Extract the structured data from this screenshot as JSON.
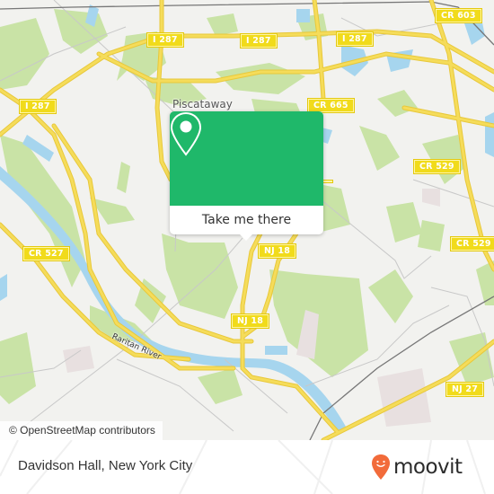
{
  "map": {
    "colors": {
      "background": "#f2f2ef",
      "park": "#c9e3a6",
      "water": "#a6d5ee",
      "road": "#f5dc5a",
      "road_casing": "#e8c83a",
      "rail": "#777777",
      "minor_road": "#c8c8c8",
      "industrial": "#e8e0e0"
    },
    "road_shields": [
      {
        "label": "I 287",
        "id": "i287-west"
      },
      {
        "label": "I 287",
        "id": "i287-north-1"
      },
      {
        "label": "I 287",
        "id": "i287-north-2"
      },
      {
        "label": "I 287",
        "id": "i287-north-3"
      },
      {
        "label": "CR 603",
        "id": "cr603"
      },
      {
        "label": "CR 665",
        "id": "cr665"
      },
      {
        "label": "CR 529",
        "id": "cr529-1"
      },
      {
        "label": "CR 529",
        "id": "cr529-2"
      },
      {
        "label": "CR 527",
        "id": "cr527"
      },
      {
        "label": "NJ 18",
        "id": "nj18-1"
      },
      {
        "label": "NJ 18",
        "id": "nj18-2"
      },
      {
        "label": "NJ 27",
        "id": "nj27"
      }
    ],
    "place_labels": {
      "piscataway": "Piscataway"
    },
    "water_labels": {
      "raritan": "Raritan River"
    }
  },
  "popup": {
    "icon": "map-pin-icon",
    "button_label": "Take me there",
    "accent_color": "#1fb86a"
  },
  "attribution": "© OpenStreetMap contributors",
  "footer": {
    "place_name": "Davidson Hall, New York City",
    "brand": {
      "wordmark": "moovit",
      "icon": "moovit-pin-smile-icon",
      "color": "#f26b3a"
    }
  }
}
